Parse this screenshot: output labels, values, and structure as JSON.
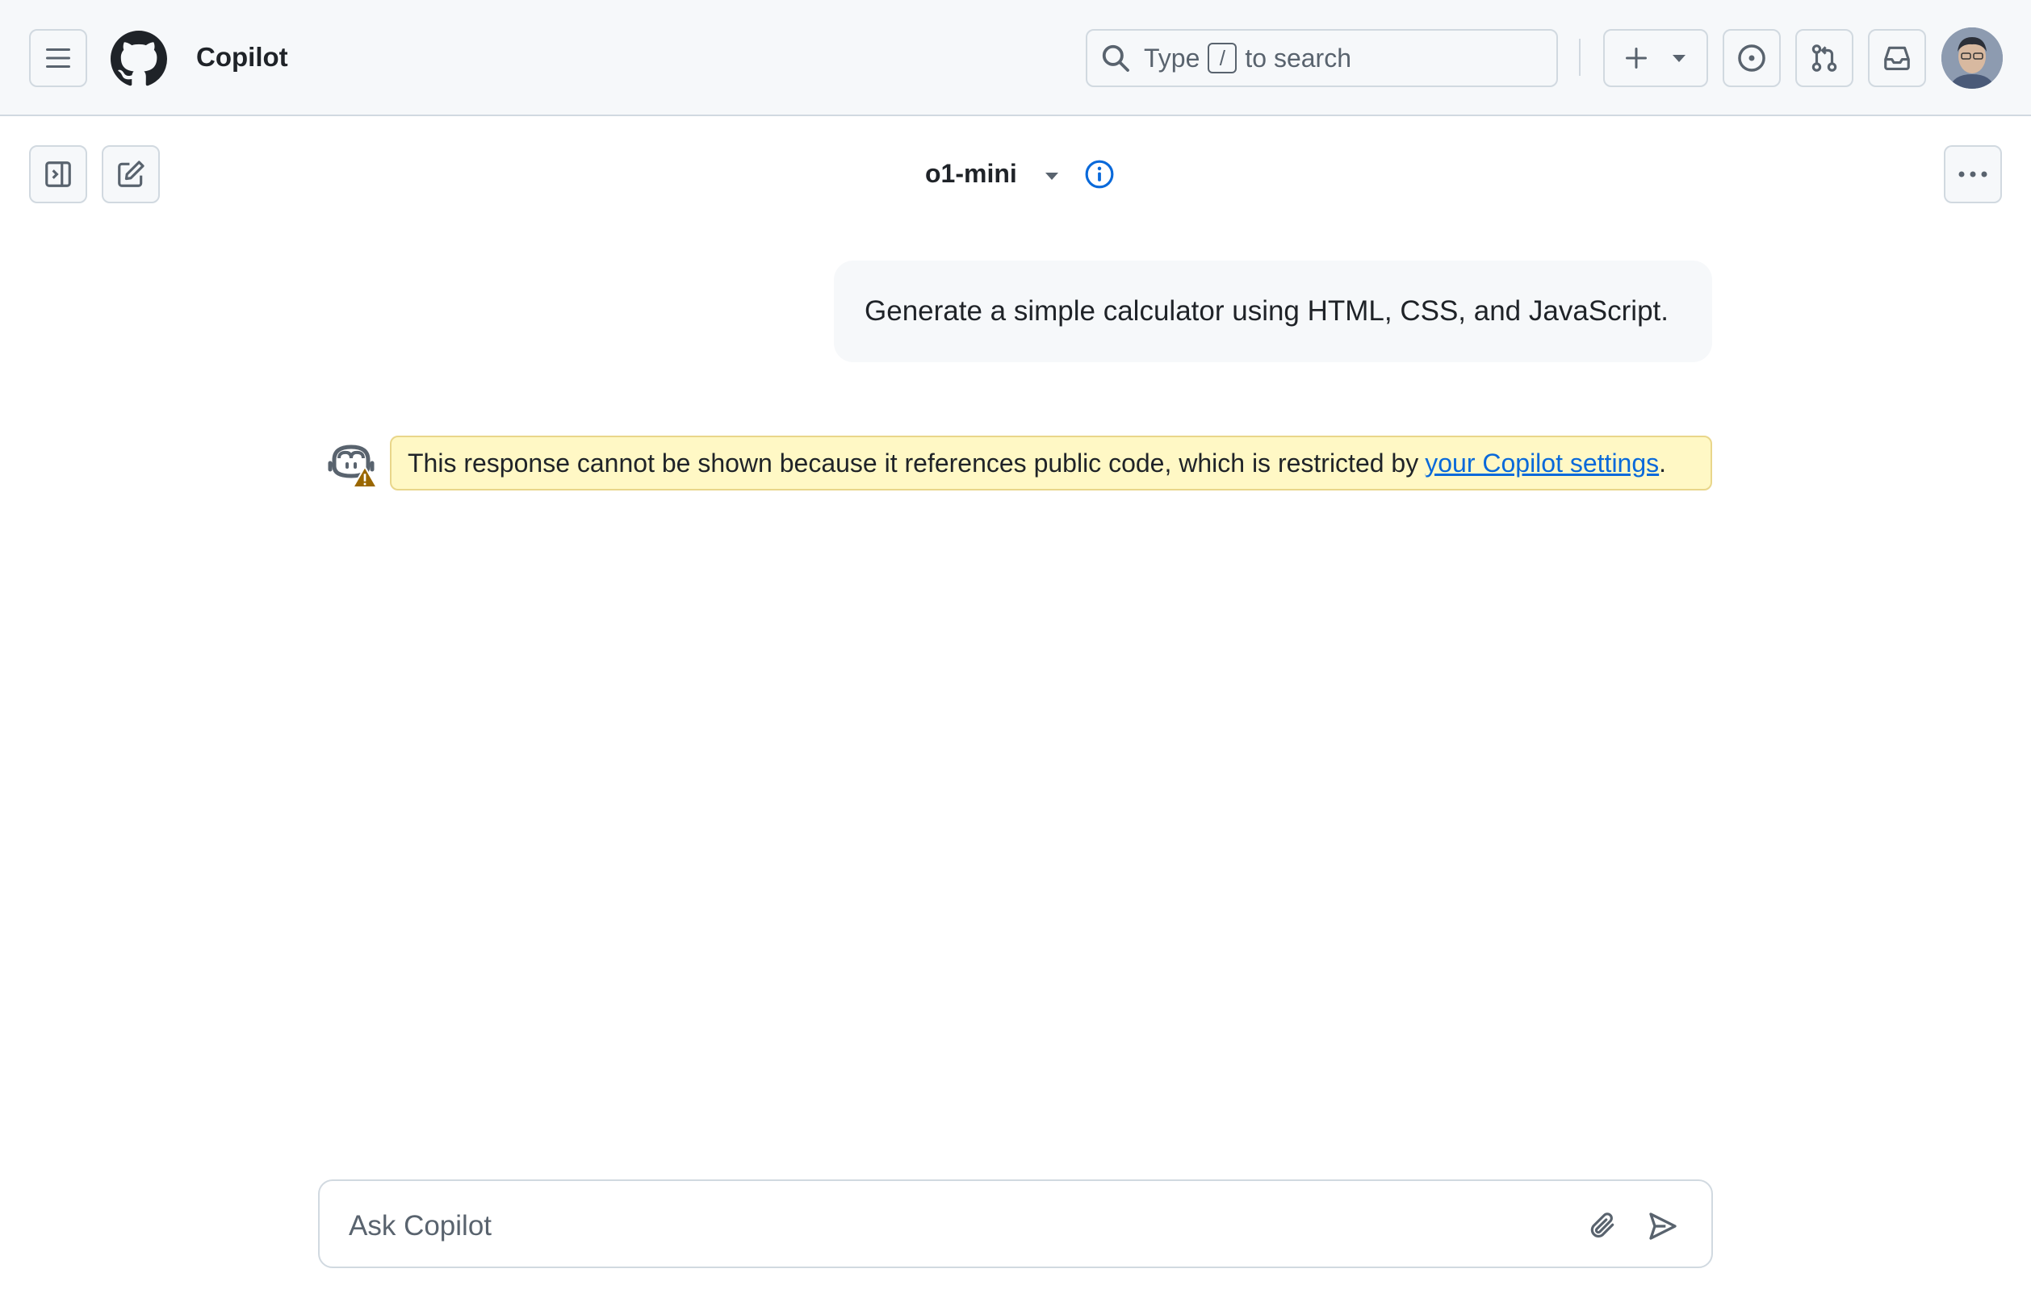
{
  "header": {
    "title": "Copilot",
    "search_prefix": "Type",
    "search_key": "/",
    "search_suffix": "to search"
  },
  "toolbar": {
    "model": "o1-mini"
  },
  "conversation": {
    "user_message": "Generate a simple calculator using HTML, CSS, and JavaScript.",
    "warning_text": "This response cannot be shown because it references public code, which is restricted by",
    "warning_link": "your Copilot settings",
    "warning_end": "."
  },
  "composer": {
    "placeholder": "Ask Copilot"
  },
  "colors": {
    "accent": "#0969da",
    "warning_bg": "#fff8c5",
    "warning_icon": "#9a6700"
  },
  "icons": [
    "menu-icon",
    "github-logo-icon",
    "search-icon",
    "plus-icon",
    "triangle-down-icon",
    "issue-icon",
    "pull-request-icon",
    "inbox-icon",
    "sidebar-toggle-icon",
    "new-chat-icon",
    "info-icon",
    "kebab-icon",
    "copilot-icon",
    "alert-icon",
    "paperclip-icon",
    "send-icon"
  ]
}
